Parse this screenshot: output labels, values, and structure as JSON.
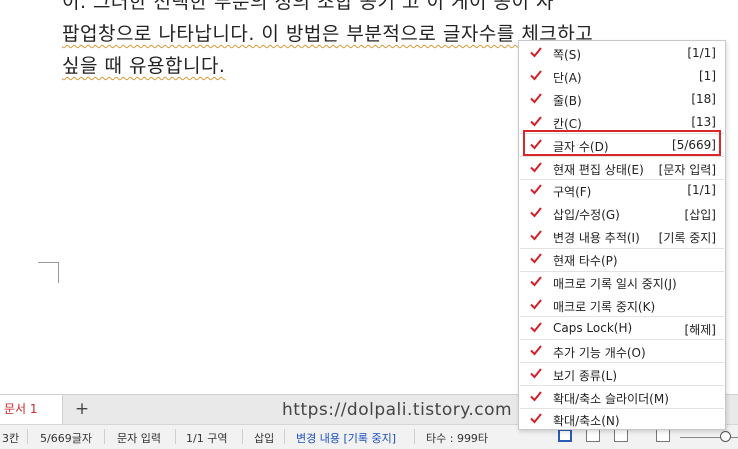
{
  "document": {
    "lines": [
      "이. 그러한 선택한 부분의 정의 조합 공기 고 이 게이 공이 사",
      "팝업창으로 나타납니다. 이 방법은 부분적으로 글자수를 체크하고",
      "싶을 때 유용합니다."
    ]
  },
  "tabs": {
    "active_label": "문서 1",
    "add_label": "+"
  },
  "watermark": "https://dolpali.tistory.com",
  "statusbar": {
    "col": "3칸",
    "chars": "5/669글자",
    "input_mode": "문자 입력",
    "section": "1/1 구역",
    "insert": "삽입",
    "track_changes": "변경 내용 [기록 중지]",
    "typing_speed": "타수 : 999타"
  },
  "menu": {
    "items": [
      {
        "label": "쪽(S)",
        "value": "[1/1]"
      },
      {
        "label": "단(A)",
        "value": "[1]"
      },
      {
        "label": "줄(B)",
        "value": "[18]"
      },
      {
        "label": "칸(C)",
        "value": "[13]"
      },
      {
        "label": "글자 수(D)",
        "value": "[5/669]"
      },
      {
        "label": "현재 편집 상태(E)",
        "value": "[문자 입력]"
      },
      {
        "label": "구역(F)",
        "value": "[1/1]"
      },
      {
        "label": "삽입/수정(G)",
        "value": "[삽입]"
      },
      {
        "label": "변경 내용 추적(I)",
        "value": "[기록 중지]"
      },
      {
        "label": "현재 타수(P)",
        "value": ""
      },
      {
        "label": "매크로 기록 일시 중지(J)",
        "value": ""
      },
      {
        "label": "매크로 기록 중지(K)",
        "value": ""
      },
      {
        "label": "Caps Lock(H)",
        "value": "[해제]"
      },
      {
        "label": "추가 기능 개수(O)",
        "value": ""
      },
      {
        "label": "보기 종류(L)",
        "value": ""
      },
      {
        "label": "확대/축소 슬라이더(M)",
        "value": ""
      },
      {
        "label": "확대/축소(N)",
        "value": ""
      }
    ]
  },
  "colors": {
    "check": "#d0202a",
    "highlight": "#d9262b",
    "active_tab_text": "#cc2a2a",
    "track_changes_text": "#1a4fc0"
  }
}
